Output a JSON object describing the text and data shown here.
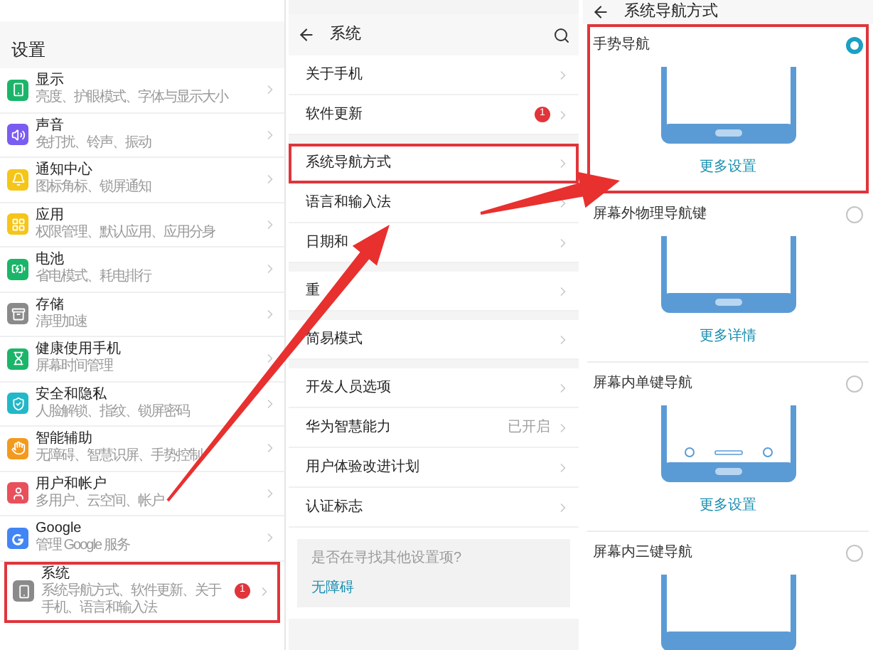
{
  "settings": {
    "title": "设置",
    "items": [
      {
        "title": "显示",
        "subtitle": "亮度、护眼模式、字体与显示大小",
        "color": "#1bb56a",
        "annotated": false
      },
      {
        "title": "声音",
        "subtitle": "免打扰、铃声、振动",
        "color": "#7b5cf0",
        "annotated": false
      },
      {
        "title": "通知中心",
        "subtitle": "图标角标、锁屏通知",
        "color": "#f5c518",
        "annotated": false
      },
      {
        "title": "应用",
        "subtitle": "权限管理、默认应用、应用分身",
        "color": "#f5c518",
        "annotated": false
      },
      {
        "title": "电池",
        "subtitle": "省电模式、耗电排行",
        "color": "#1bb56a",
        "annotated": false
      },
      {
        "title": "存储",
        "subtitle": "清理加速",
        "color": "#8a8a8a",
        "annotated": false
      },
      {
        "title": "健康使用手机",
        "subtitle": "屏幕时间管理",
        "color": "#1bb56a",
        "annotated": false
      },
      {
        "title": "安全和隐私",
        "subtitle": "人脸解锁、指纹、锁屏密码",
        "color": "#22b8c8",
        "annotated": false
      },
      {
        "title": "智能辅助",
        "subtitle": "无障碍、智慧识屏、手势控制",
        "color": "#f39a1e",
        "annotated": false
      },
      {
        "title": "用户和帐户",
        "subtitle": "多用户、云空间、帐户",
        "color": "#e8505b",
        "annotated": false
      },
      {
        "title": "Google",
        "subtitle": "管理 Google 服务",
        "color": "#4285f4",
        "annotated": false
      },
      {
        "title": "系统",
        "subtitle": "系统导航方式、软件更新、关于手机、语言和输入法",
        "color": "#8a8a8a",
        "badge": "1",
        "annotated": true
      }
    ]
  },
  "system": {
    "title": "系统",
    "groups": [
      [
        {
          "label": "关于手机",
          "annotated": false
        },
        {
          "label": "软件更新",
          "badge": "1",
          "annotated": false
        }
      ],
      [
        {
          "label": "系统导航方式",
          "annotated": true
        },
        {
          "label": "语言和输入法",
          "annotated": false
        },
        {
          "label": "日期和",
          "annotated": false
        }
      ],
      [
        {
          "label": "重",
          "annotated": false
        }
      ],
      [
        {
          "label": "简易模式",
          "annotated": false
        }
      ],
      [
        {
          "label": "开发人员选项",
          "annotated": false
        },
        {
          "label": "华为智慧能力",
          "value": "已开启",
          "annotated": false
        },
        {
          "label": "用户体验改进计划",
          "annotated": false
        },
        {
          "label": "认证标志",
          "annotated": false
        }
      ]
    ],
    "suggestion": {
      "question": "是否在寻找其他设置项?",
      "link": "无障碍"
    }
  },
  "navigation": {
    "title": "系统导航方式",
    "options": [
      {
        "label": "手势导航",
        "kind": "gesture",
        "selected": true,
        "link": "更多设置",
        "annotated": true
      },
      {
        "label": "屏幕外物理导航键",
        "kind": "physical",
        "selected": false,
        "link": "更多详情",
        "annotated": false
      },
      {
        "label": "屏幕内单键导航",
        "kind": "single",
        "selected": false,
        "link": "更多设置",
        "annotated": false
      },
      {
        "label": "屏幕内三键导航",
        "kind": "triple",
        "selected": false,
        "annotated": false
      }
    ]
  }
}
